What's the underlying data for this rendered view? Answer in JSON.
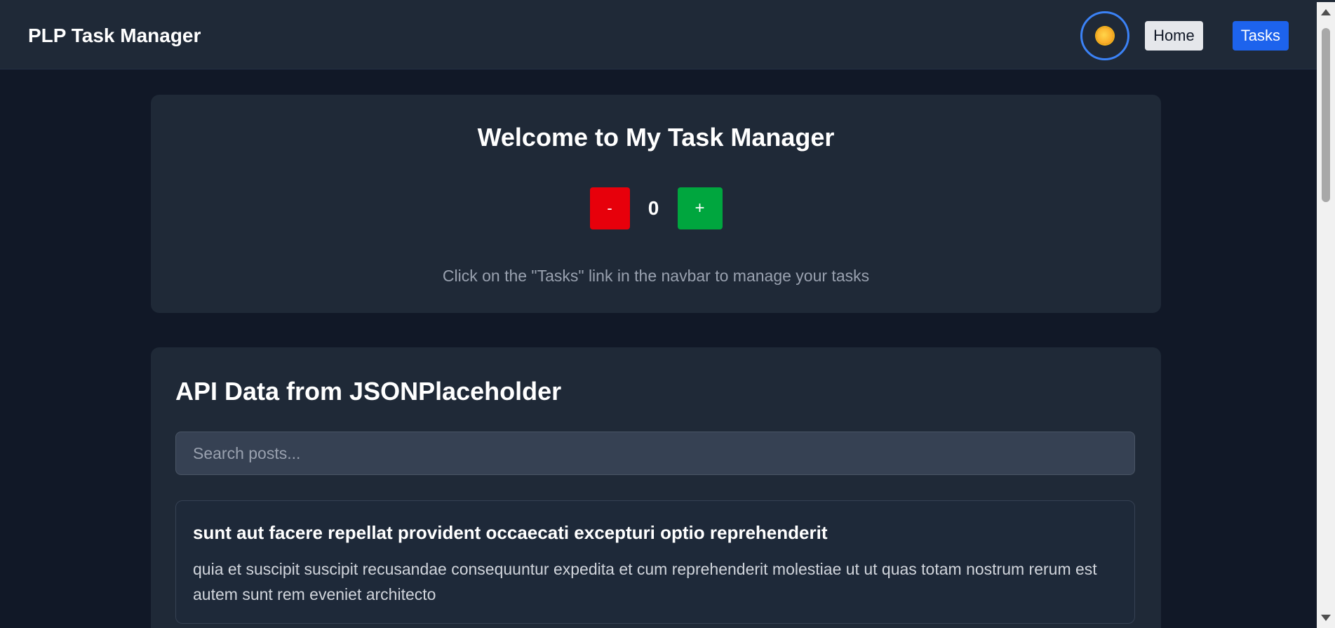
{
  "navbar": {
    "brand": "PLP Task Manager",
    "theme_toggle_icon": "sun-icon",
    "home_label": "Home",
    "tasks_label": "Tasks"
  },
  "welcome": {
    "title": "Welcome to My Task Manager",
    "minus_label": "-",
    "count": "0",
    "plus_label": "+",
    "hint": "Click on the \"Tasks\" link in the navbar to manage your tasks"
  },
  "api": {
    "title": "API Data from JSONPlaceholder",
    "search_placeholder": "Search posts...",
    "posts": [
      {
        "title": "sunt aut facere repellat provident occaecati excepturi optio reprehenderit",
        "body": "quia et suscipit suscipit recusandae consequuntur expedita et cum reprehenderit molestiae ut ut quas totam nostrum rerum est autem sunt rem eveniet architecto"
      }
    ]
  },
  "colors": {
    "page_bg": "#111827",
    "card_bg": "#1f2937",
    "accent_blue": "#1d63ed",
    "minus_red": "#e7000b",
    "plus_green": "#00a63e"
  }
}
